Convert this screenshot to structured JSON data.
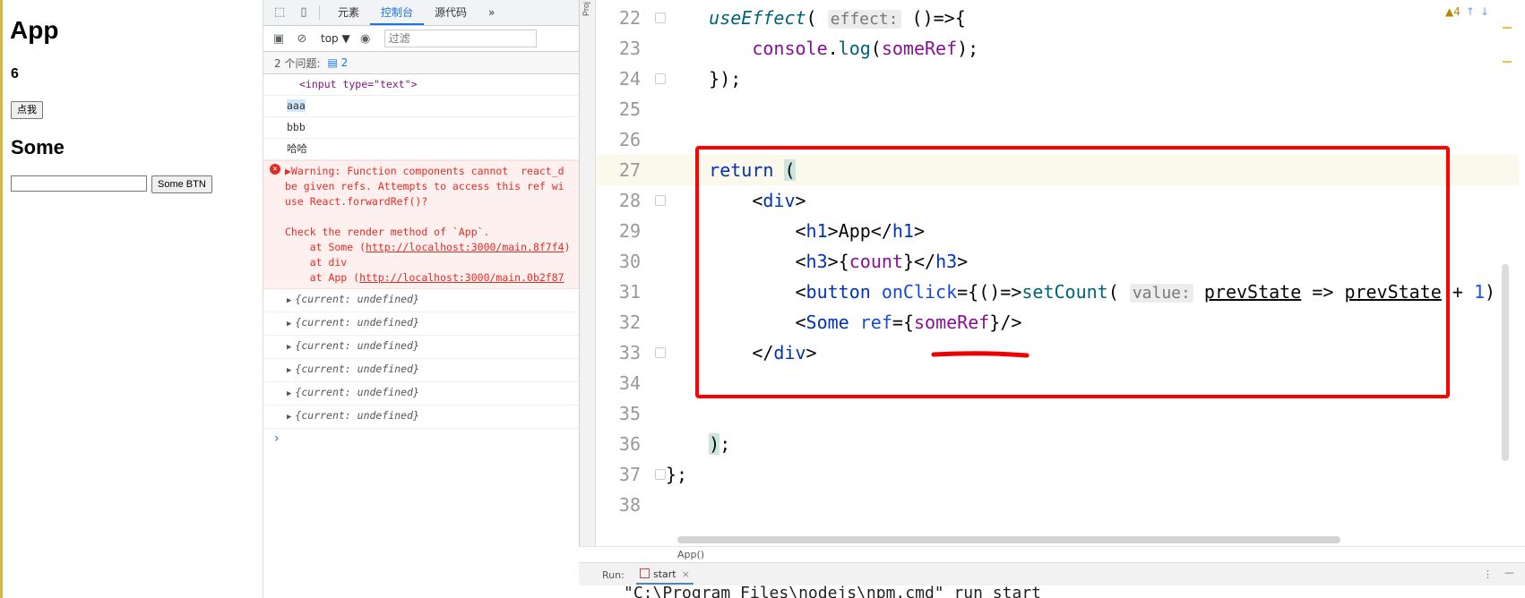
{
  "app": {
    "title": "App",
    "count": "6",
    "click_button": "点我",
    "some_heading": "Some",
    "some_input_value": "",
    "some_button": "Some BTN"
  },
  "devtools": {
    "tabs": [
      "元素",
      "控制台",
      "源代码"
    ],
    "more_tabs": "»",
    "context": "top ▼",
    "filter_placeholder": "过滤",
    "issues_label": "2 个问题:",
    "issues_count": "2",
    "logs": {
      "input_tag": "<input type=\"text\">",
      "aaa": "aaa",
      "bbb": "bbb",
      "haha": "哈哈",
      "error_text": "▶Warning: Function components cannot  react_d\nbe given refs. Attempts to access this ref wi\nuse React.forwardRef()?\n\nCheck the render method of `App`.\n    at Some (",
      "error_link1": "http://localhost:3000/main.8f7f4",
      "error_mid": ")\n    at div\n    at App (",
      "error_link2": "http://localhost:3000/main.0b2f87",
      "obj1": "{current: undefined}",
      "obj2": "{current: undefined}",
      "obj3": "{current: undefined}",
      "obj4": "{current: undefined}",
      "obj5": "{current: undefined}",
      "obj6": "{current: undefined}"
    },
    "prompt": "›"
  },
  "ide": {
    "project_label": "Proj",
    "warnings": "▲4",
    "lines": {
      "l22": "22",
      "l23": "23",
      "l24": "24",
      "l25": "25",
      "l26": "26",
      "l27": "27",
      "l28": "28",
      "l29": "29",
      "l30": "30",
      "l31": "31",
      "l32": "32",
      "l33": "33",
      "l34": "34",
      "l35": "35",
      "l36": "36",
      "l37": "37",
      "l38": "38"
    },
    "breadcrumb": "App()",
    "run_label": "Run:",
    "run_tab": "start",
    "terminal": "\"C:\\Program Files\\nodejs\\npm.cmd\" run start"
  }
}
